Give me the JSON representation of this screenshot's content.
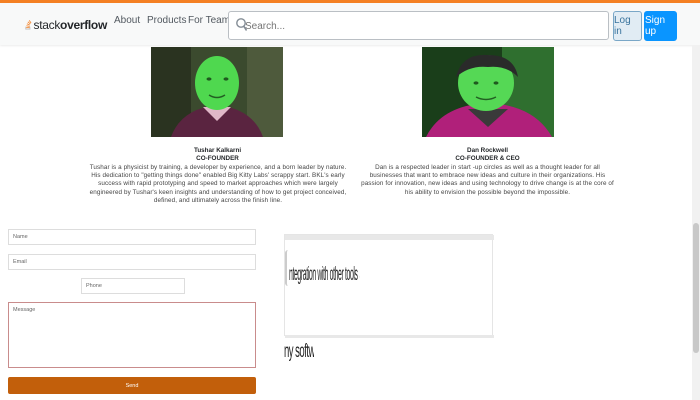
{
  "header": {
    "logo_plain": "stack",
    "logo_bold": "overflow",
    "nav": [
      "About",
      "Products",
      "For Teams"
    ],
    "search_placeholder": "Search...",
    "login_label": "Log in",
    "signup_label": "Sign up"
  },
  "team": [
    {
      "name": "Tushar Kalkarni",
      "role": "CO-FOUNDER",
      "bio": "Tushar is a physicist by training, a developer by experience, and a born leader by nature. His dedication to \"getting things done\" enabled Big Kitty Labs' scrappy start. BKL's early success with rapid prototyping and speed to market approaches which were largely engineered by Tushar's keen insights and understanding of how to get project conceived, defined, and ultimately across the finish line."
    },
    {
      "name": "Dan Rockwell",
      "role": "CO-FOUNDER & CEO",
      "bio": "Dan is a respected leader in start -up circles as well as a thought leader for all businesses that want to embrace new ideas and culture in their organizations. His passion for innovation, new ideas and using technology to drive change is at the core of his ability to envision the possible beyond the impossible."
    }
  ],
  "form": {
    "name_placeholder": "Name",
    "email_placeholder": "Email",
    "phone_placeholder": "Phone",
    "message_placeholder": "Message",
    "send_label": "Send"
  },
  "embed": {
    "line1": "ntegration with other tools and the Big Kitty Labs API. Thought and Experience are the basis of cur",
    "line2": "ny software"
  },
  "colors": {
    "accent": "#f48024",
    "signup": "#0a95ff",
    "send": "#c25f0b"
  }
}
